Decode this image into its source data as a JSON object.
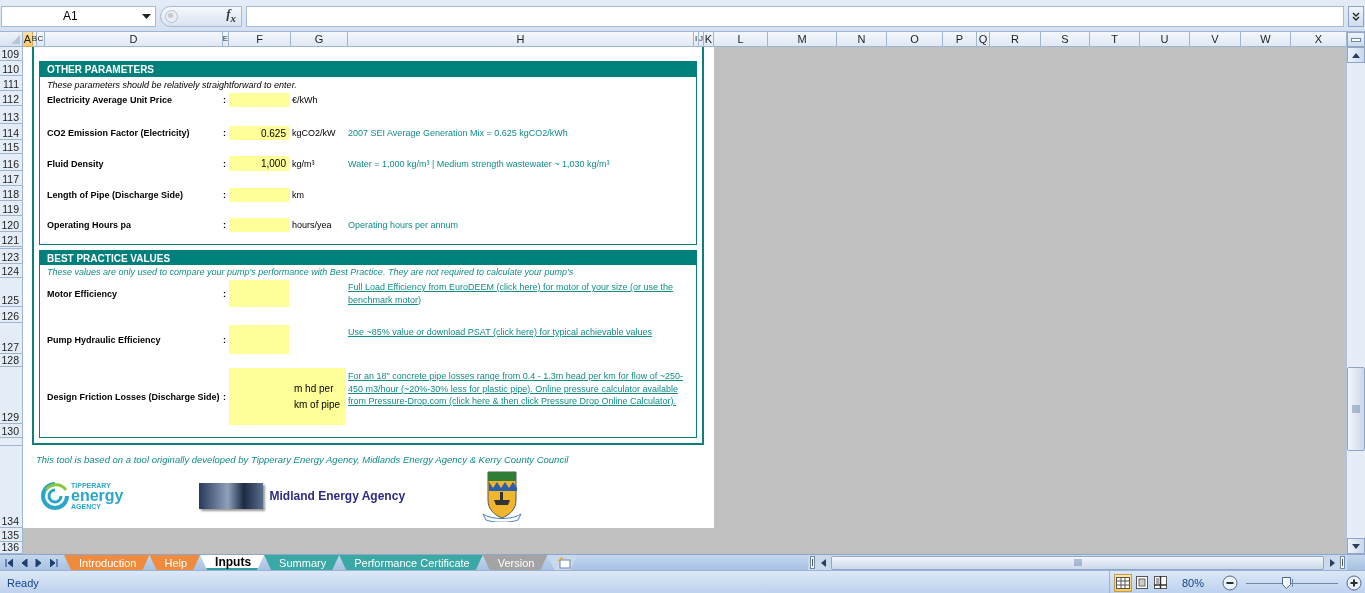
{
  "formula_bar": {
    "name_box": "A1",
    "function_button": "f$_{x}$"
  },
  "columns": [
    {
      "label": "A",
      "selected": true
    },
    {
      "label": "B",
      "selected": false
    },
    {
      "label": "C",
      "selected": false
    },
    {
      "label": "D",
      "selected": false
    },
    {
      "label": "E",
      "selected": false
    },
    {
      "label": "F",
      "selected": false
    },
    {
      "label": "G",
      "selected": false
    },
    {
      "label": "H",
      "selected": false
    },
    {
      "label": "I",
      "selected": false
    },
    {
      "label": "J",
      "selected": false
    },
    {
      "label": "K",
      "selected": false
    },
    {
      "label": "L",
      "selected": false
    },
    {
      "label": "M",
      "selected": false
    },
    {
      "label": "N",
      "selected": false
    },
    {
      "label": "O",
      "selected": false
    },
    {
      "label": "P",
      "selected": false
    },
    {
      "label": "Q",
      "selected": false
    },
    {
      "label": "R",
      "selected": false
    },
    {
      "label": "S",
      "selected": false
    },
    {
      "label": "T",
      "selected": false
    },
    {
      "label": "U",
      "selected": false
    },
    {
      "label": "V",
      "selected": false
    },
    {
      "label": "W",
      "selected": false
    },
    {
      "label": "X",
      "selected": false
    }
  ],
  "rows": [
    "109",
    "110",
    "111",
    "112",
    "113",
    "114",
    "115",
    "116",
    "117",
    "118",
    "119",
    "120",
    "121",
    "123",
    "124",
    "125",
    "126",
    "127",
    "128",
    "129",
    "130",
    "134",
    "135",
    "136"
  ],
  "other_parameters": {
    "title": "OTHER PARAMETERS",
    "intro": "These parameters should be relatively straightforward to enter.",
    "params": [
      {
        "label": "Electricity Average Unit Price",
        "separator": ":",
        "unit": "€/kWh"
      },
      {
        "label": "CO2 Emission Factor (Electricity)",
        "separator": ":",
        "value": "0.625",
        "unit": "kgCO2/kW",
        "note": "2007 SEI Average Generation Mix = 0.625 kgCO2/kWh"
      },
      {
        "label": "Fluid Density",
        "separator": ":",
        "value": "1,000",
        "unit": "kg/m³",
        "note": "Water = 1,000 kg/m³ | Medium strength wastewater ~ 1,030 kg/m³"
      },
      {
        "label": "Length of Pipe (Discharge Side)",
        "separator": ":",
        "unit": "km"
      },
      {
        "label": "Operating Hours pa",
        "separator": ":",
        "unit": "hours/yea",
        "note": "Operating hours per annum"
      }
    ]
  },
  "best_practice_values": {
    "title": "BEST PRACTICE VALUES",
    "intro": "These values are only used to compare your pump's performance with Best Practice. They are not required to calculate your pump's",
    "params": [
      {
        "label": "Motor Efficiency",
        "separator": ":",
        "note": "Full Load Efficiency from EuroDEEM (click here) for motor of your size (or use the benchmark motor)"
      },
      {
        "label": "Pump Hydraulic Efficiency",
        "separator": ":",
        "note": "Use ~85% value or download PSAT (click here) for typical achievable values"
      },
      {
        "label": "Design Friction Losses (Discharge Side)",
        "separator": ":",
        "unit": "m hd per km of pipe",
        "note": "For an 18\" concrete pipe losses range from 0.4 - 1.3m head per km for flow of ~250-450 m3/hour (~20%-30% less for plastic pipe).  Online pressure calculator available from Pressure-Drop.com (click here & then click Pressure Drop Online Calculator)."
      }
    ]
  },
  "credits": "This tool is based on a tool originally developed by Tipperary Energy Agency, Midlands Energy Agency & Kerry County Council",
  "logos": {
    "tipperary": {
      "top": "TIPPERARY",
      "main": "energy",
      "bottom": "AGENCY"
    },
    "midland": "Midland Energy Agency"
  },
  "sheet_tabs": [
    {
      "label": "Introduction",
      "selected": false,
      "color": "#f08a3c"
    },
    {
      "label": "Help",
      "selected": false,
      "color": "#f08a3c"
    },
    {
      "label": "Inputs",
      "selected": true,
      "color": "#2f9e9a"
    },
    {
      "label": "Summary",
      "selected": false,
      "color": "#3aa8a4"
    },
    {
      "label": "Performance Certificate",
      "selected": false,
      "color": "#3aa8a4"
    },
    {
      "label": "Version",
      "selected": false,
      "color": "#a3a3a3"
    }
  ],
  "status_bar": {
    "status": "Ready",
    "views": [
      {
        "kind": "normal",
        "selected": true
      },
      {
        "kind": "page_layout",
        "selected": false
      },
      {
        "kind": "page_break",
        "selected": false
      }
    ],
    "zoom": "80%",
    "zoom_slider": {
      "level": 0.43
    }
  }
}
